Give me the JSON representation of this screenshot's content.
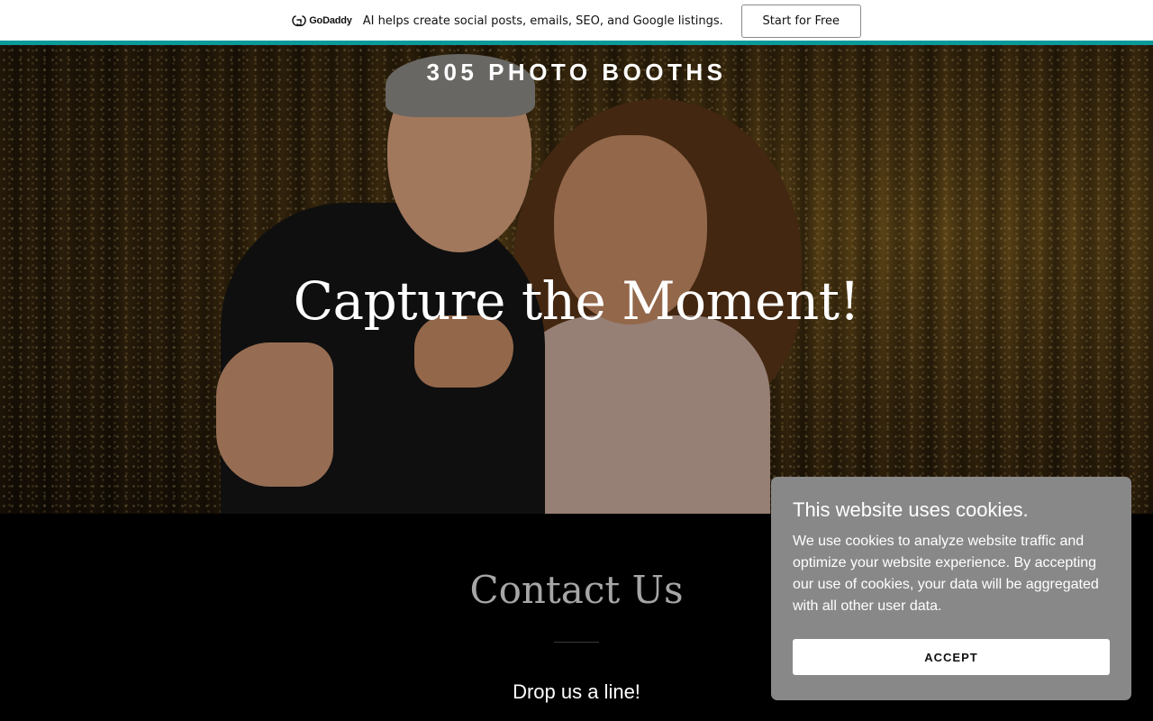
{
  "promo": {
    "logo_text": "GoDaddy",
    "logo_icon": "godaddy-logo-icon",
    "message": "AI helps create social posts, emails, SEO, and Google listings.",
    "cta_label": "Start for Free",
    "accent_color": "#0b9a9a"
  },
  "hero": {
    "site_title": "305 PHOTO BOOTHS",
    "heading": "Capture the Moment!"
  },
  "contact": {
    "title": "Contact Us",
    "subtitle": "Drop us a line!"
  },
  "cookie_banner": {
    "title": "This website uses cookies.",
    "body": "We use cookies to analyze website traffic and optimize your website experience. By accepting our use of cookies, your data will be aggregated with all other user data.",
    "accept_label": "ACCEPT",
    "background_color": "#888888"
  }
}
